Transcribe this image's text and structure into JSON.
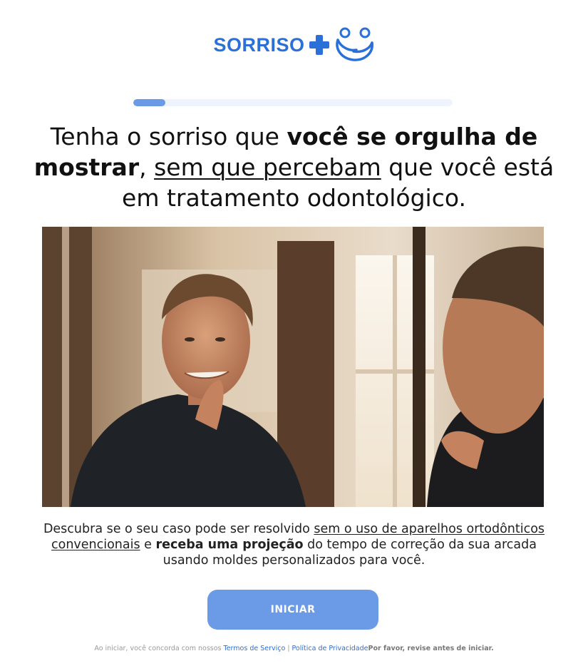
{
  "brand": {
    "name": "SORRISO",
    "primary_color": "#2b6fd8",
    "accent_color": "#6b9be6"
  },
  "progress": {
    "fraction": 0.1
  },
  "headline": {
    "part1": "Tenha o sorriso que ",
    "bold1": "você se orgulha de mostrar",
    "part2": ", ",
    "underlined": "sem que percebam",
    "part3": " que você está em tratamento odontológico."
  },
  "hero_image": {
    "icon": "man-smiling-at-mirror-photo"
  },
  "description": {
    "part1": "Descubra se o seu caso pode ser resolvido ",
    "underlined": "sem o uso de aparelhos ortodônticos convencionais",
    "part2": " e ",
    "bold": "receba uma projeção",
    "part3": " do tempo de correção da sua arcada usando moldes personalizados para você."
  },
  "cta": {
    "label": "INICIAR"
  },
  "footer": {
    "prefix": "Ao iniciar, você concorda com nossos ",
    "terms_link": "Termos de Serviço",
    "separator": " | ",
    "privacy_link": "Política de Privacidade",
    "notice": "Por favor, revise antes de iniciar."
  }
}
